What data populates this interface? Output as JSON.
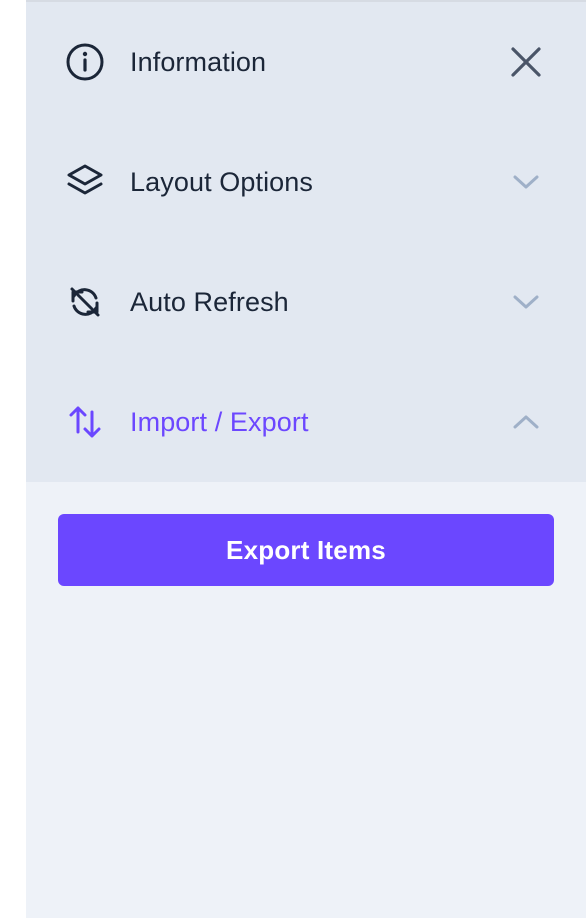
{
  "sections": [
    {
      "label": "Information",
      "icon": "info-circle-icon",
      "toggle_icon": "close-icon",
      "expanded": false
    },
    {
      "label": "Layout Options",
      "icon": "layers-icon",
      "toggle_icon": "chevron-down-icon",
      "expanded": false
    },
    {
      "label": "Auto Refresh",
      "icon": "refresh-off-icon",
      "toggle_icon": "chevron-down-icon",
      "expanded": false
    },
    {
      "label": "Import / Export",
      "icon": "arrows-up-down-icon",
      "toggle_icon": "chevron-up-icon",
      "expanded": true
    }
  ],
  "import_export": {
    "export_button_label": "Export Items"
  },
  "colors": {
    "accent": "#6b47ff",
    "text": "#1b2638",
    "header_bg": "#e2e8f1",
    "panel_bg": "#eef2f8",
    "chevron": "#9fb0c8"
  }
}
